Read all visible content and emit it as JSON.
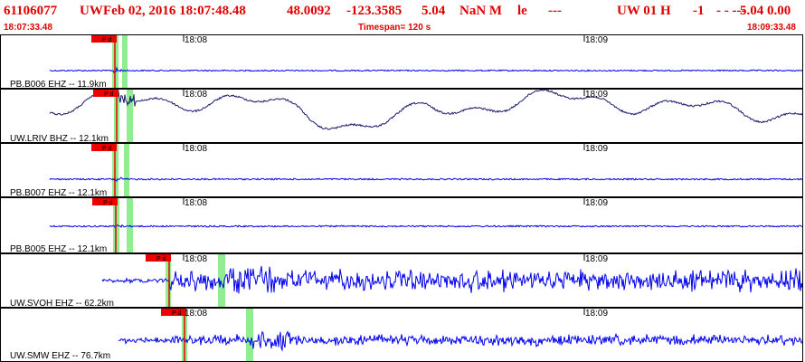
{
  "header": {
    "event_id": "61106077",
    "network": "UW",
    "datetime": "Feb 02, 2016 18:07:48.48",
    "lat": "48.0092",
    "lon": "-123.3585",
    "depth": "5.04",
    "magnitude": "NaN M",
    "mag_type": "le",
    "dashes1": "---",
    "source": "UW 01 H",
    "quality": "-1",
    "flags": "- - ---",
    "extra": "5.04 0.00"
  },
  "subheader": {
    "start_time": "18:07:33.48",
    "timespan": "Timespan= 120 s",
    "end_time": "18:09:33.48"
  },
  "time_labels": [
    "18:08",
    "18:09"
  ],
  "pick_label": "P d",
  "colors": {
    "header_red": "#e00000",
    "trace_blue": "#0000ee",
    "trace_navy": "#1a1a6e",
    "pick_red": "#ee0000",
    "window_green": "#90ee90"
  },
  "channels": [
    {
      "label": "PB.B006 EHZ -- 11.9km",
      "style": "quiet",
      "trace_color": "#0000ee"
    },
    {
      "label": "UW.LRIV BHZ -- 12.1km",
      "style": "wavy",
      "trace_color": "#1a1a6e"
    },
    {
      "label": "PB.B007 EHZ -- 12.1km",
      "style": "quiet",
      "trace_color": "#0000ee"
    },
    {
      "label": "PB.B005 EHZ -- 12.1km",
      "style": "quiet",
      "trace_color": "#0000ee"
    },
    {
      "label": "UW.SVOH EHZ -- 62.2km",
      "style": "noisy",
      "trace_color": "#0000ee"
    },
    {
      "label": "UW.SMW EHZ -- 76.7km",
      "style": "burst",
      "trace_color": "#0000ee"
    }
  ]
}
